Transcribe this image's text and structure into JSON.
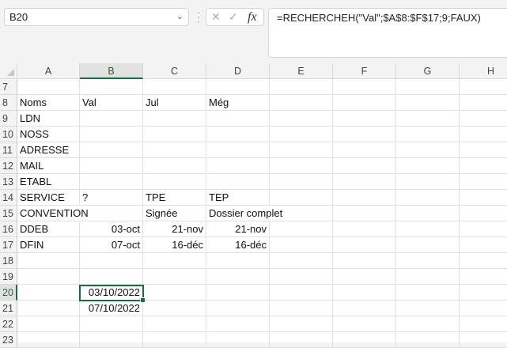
{
  "name_box": "B20",
  "formula": "=RECHERCHEH(\"Val\";$A$8:$F$17;9;FAUX)",
  "columns": [
    "A",
    "B",
    "C",
    "D",
    "E",
    "F",
    "G",
    "H"
  ],
  "selected_column": "B",
  "selected_row": "20",
  "rows": [
    {
      "num": "7",
      "cells": [
        "",
        "",
        "",
        ""
      ]
    },
    {
      "num": "8",
      "cells": [
        "Noms",
        "Val",
        "Jul",
        "Még"
      ]
    },
    {
      "num": "9",
      "cells": [
        "LDN",
        "",
        "",
        ""
      ]
    },
    {
      "num": "10",
      "cells": [
        "NOSS",
        "",
        "",
        ""
      ]
    },
    {
      "num": "11",
      "cells": [
        "ADRESSE",
        "",
        "",
        ""
      ]
    },
    {
      "num": "12",
      "cells": [
        "MAIL",
        "",
        "",
        ""
      ]
    },
    {
      "num": "13",
      "cells": [
        "ETABL",
        "",
        "",
        ""
      ]
    },
    {
      "num": "14",
      "cells": [
        "SERVICE",
        "?",
        "TPE",
        "TEP"
      ]
    },
    {
      "num": "15",
      "cells": [
        "CONVENTION",
        "",
        "Signée",
        "Dossier complet"
      ]
    },
    {
      "num": "16",
      "cells": [
        "DDEB",
        "03-oct",
        "21-nov",
        "21-nov"
      ]
    },
    {
      "num": "17",
      "cells": [
        "DFIN",
        "07-oct",
        "16-déc",
        "16-déc"
      ]
    },
    {
      "num": "18",
      "cells": [
        "",
        "",
        "",
        ""
      ]
    },
    {
      "num": "19",
      "cells": [
        "",
        "",
        "",
        ""
      ]
    },
    {
      "num": "20",
      "cells": [
        "",
        "03/10/2022",
        "",
        ""
      ]
    },
    {
      "num": "21",
      "cells": [
        "",
        "07/10/2022",
        "",
        ""
      ]
    },
    {
      "num": "22",
      "cells": [
        "",
        "",
        "",
        ""
      ]
    },
    {
      "num": "23",
      "cells": [
        "",
        "",
        "",
        ""
      ]
    }
  ]
}
